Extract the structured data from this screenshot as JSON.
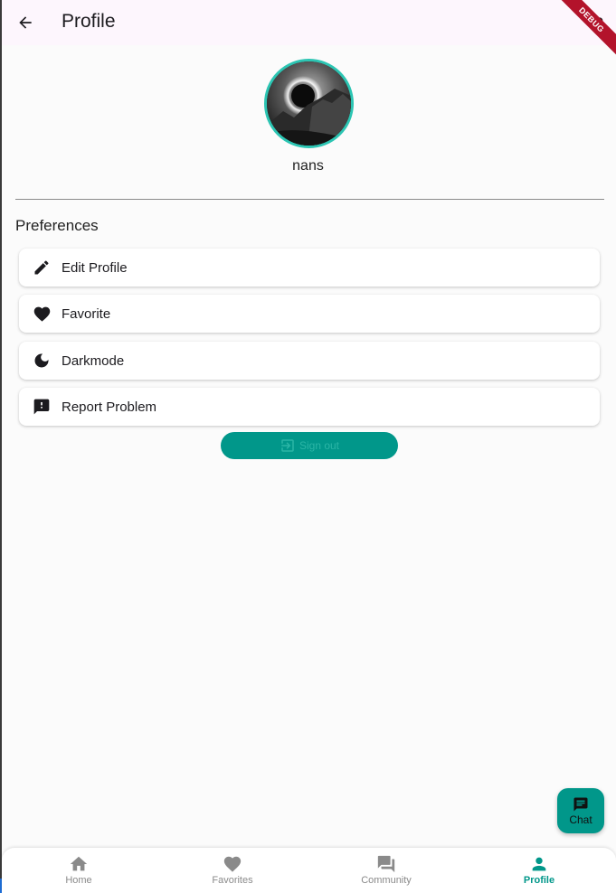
{
  "appbar": {
    "title": "Profile",
    "debug_banner": "DEBUG",
    "back_icon": "arrow-back-icon",
    "action_icon": "person-icon"
  },
  "profile": {
    "username": "nans",
    "avatar": "eclipse-photo"
  },
  "preferences": {
    "title": "Preferences",
    "items": [
      {
        "label": "Edit Profile",
        "icon": "edit-icon"
      },
      {
        "label": "Favorite",
        "icon": "heart-icon"
      },
      {
        "label": "Darkmode",
        "icon": "moon-icon"
      },
      {
        "label": "Report Problem",
        "icon": "report-icon"
      }
    ]
  },
  "signout": {
    "label": "Sign out",
    "icon": "logout-icon"
  },
  "fab": {
    "label": "Chat",
    "icon": "chat-icon"
  },
  "bottom_nav": {
    "items": [
      {
        "label": "Home",
        "icon": "home-icon",
        "active": false
      },
      {
        "label": "Favorites",
        "icon": "heart-icon",
        "active": false
      },
      {
        "label": "Community",
        "icon": "forum-icon",
        "active": false
      },
      {
        "label": "Profile",
        "icon": "person-icon",
        "active": true
      }
    ]
  },
  "colors": {
    "accent": "#01978a",
    "avatar_ring": "#2cc5b3",
    "appbar_bg": "#fdf6fd",
    "inactive_nav": "#8a8a8a"
  }
}
